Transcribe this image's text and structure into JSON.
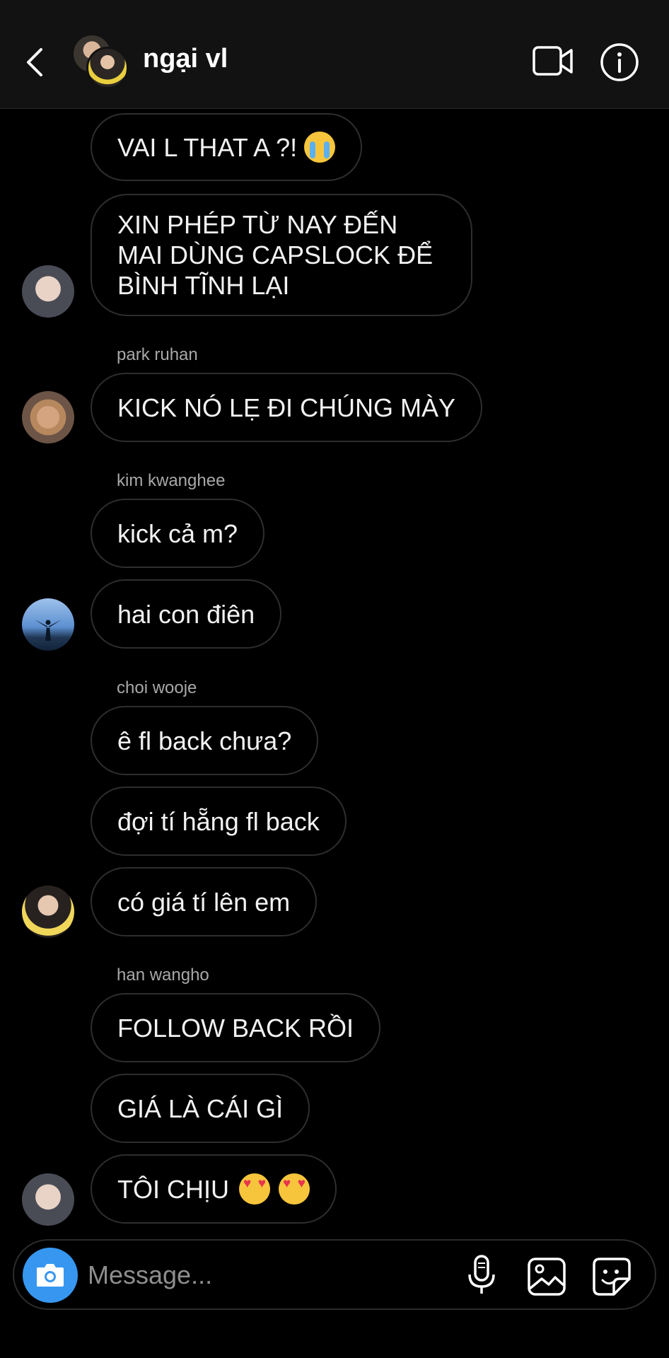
{
  "header": {
    "title": "ngại vl",
    "back_icon": "chevron-left-icon",
    "video_icon": "video-camera-icon",
    "info_icon": "info-icon"
  },
  "messages": [
    {
      "text": "VAI L THAT A ?!",
      "emoji": "loudly-crying-face"
    },
    {
      "text": "XIN PHÉP TỪ NAY ĐẾN MAI DÙNG CAPSLOCK ĐỂ BÌNH TĨNH LẠI"
    },
    {
      "sender": "park ruhan"
    },
    {
      "text": "KICK NÓ LẸ ĐI CHÚNG MÀY"
    },
    {
      "sender": "kim kwanghee"
    },
    {
      "text": "kick cả m?"
    },
    {
      "text": "hai con điên"
    },
    {
      "sender": "choi wooje"
    },
    {
      "text": "ê fl back chưa?"
    },
    {
      "text": "đợi tí hẵng fl back"
    },
    {
      "text": "có giá tí lên em"
    },
    {
      "sender": "han wangho"
    },
    {
      "text": "FOLLOW BACK RỒI"
    },
    {
      "text": "GIÁ LÀ CÁI GÌ"
    },
    {
      "text": "TÔI CHỊU",
      "emoji": "smiling-face-with-heart-eyes x2"
    }
  ],
  "composer": {
    "placeholder": "Message...",
    "camera_icon": "camera-icon",
    "mic_icon": "microphone-icon",
    "gallery_icon": "image-gallery-icon",
    "sticker_icon": "sticker-icon"
  },
  "colors": {
    "background": "#000000",
    "header_bg": "#121212",
    "bubble_border": "#2e2e2e",
    "sender_text": "#a8a8a8",
    "camera_button": "#3797f0"
  }
}
